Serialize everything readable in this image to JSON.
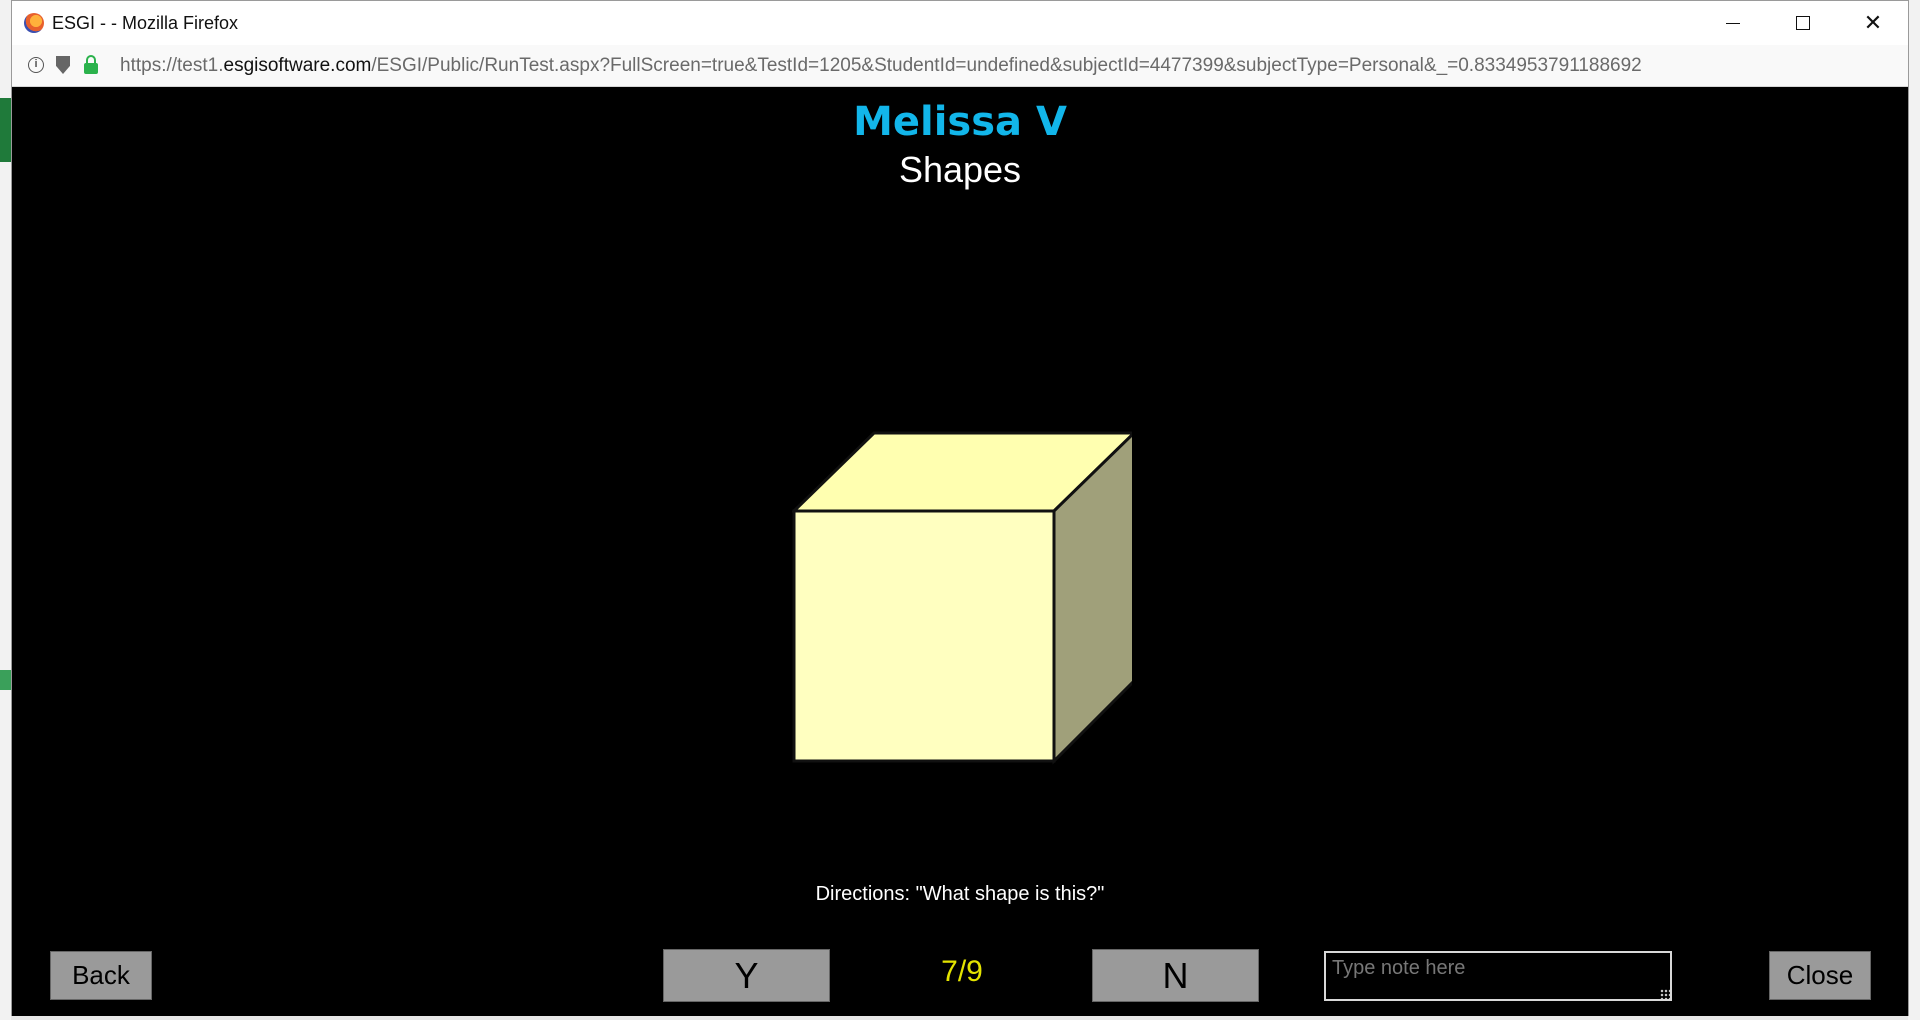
{
  "window": {
    "title": "ESGI - - Mozilla Firefox",
    "url_prefix": "https://test1.",
    "url_host": "esgisoftware.com",
    "url_path": "/ESGI/Public/RunTest.aspx?FullScreen=true&TestId=1205&StudentId=undefined&subjectId=4477399&subjectType=Personal&_=0.8334953791188692"
  },
  "test": {
    "student_name": "Melissa V",
    "subject": "Shapes",
    "image_icon": "cube-shape",
    "directions": "Directions: \"What shape is this?\"",
    "progress": "7/9"
  },
  "controls": {
    "back_label": "Back",
    "yes_label": "Y",
    "no_label": "N",
    "close_label": "Close",
    "note_placeholder": "Type note here"
  },
  "colors": {
    "name_color": "#12b6ea",
    "counter_color": "#e4e400",
    "cube_front": "#ffffc0",
    "cube_top": "#ffffb0",
    "cube_side": "#a0a07a"
  }
}
